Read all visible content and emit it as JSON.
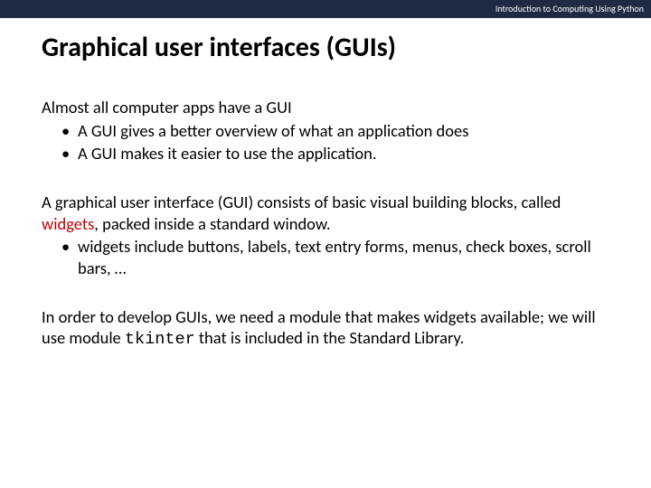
{
  "topbar": {
    "text": "Introduction to Computing Using Python"
  },
  "title": "Graphical user interfaces (GUIs)",
  "p1": {
    "lead": "Almost all computer apps have a GUI",
    "b1": "A GUI gives a better overview of what an application does",
    "b2": "A GUI makes it easier to use the application."
  },
  "p2": {
    "pre": "A graphical user interface (GUI) consists of basic visual building blocks, called ",
    "accent": "widgets",
    "post": ", packed inside a standard window.",
    "b1": "widgets include buttons, labels, text entry forms, menus, check boxes, scroll bars, …"
  },
  "p3": {
    "pre": "In order to develop GUIs, we need a module that makes widgets available; we will use module ",
    "mono": "tkinter",
    "post": " that is included in the Standard Library."
  }
}
